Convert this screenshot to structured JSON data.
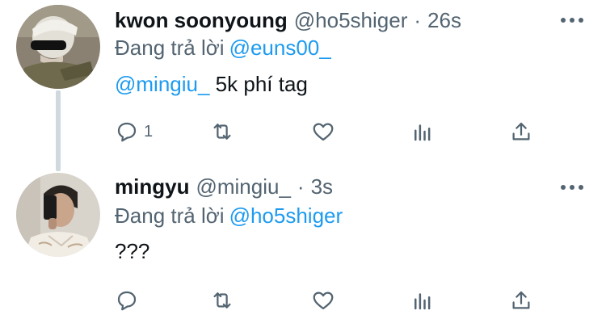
{
  "colors": {
    "link": "#1d9bf0",
    "secondary_text": "#536471",
    "primary_text": "#0f1419",
    "thread_line": "#cfd9de"
  },
  "tweets": [
    {
      "display_name": "kwon soonyoung",
      "handle": "@ho5shiger",
      "dot": "·",
      "time": "26s",
      "reply_prefix": "Đang trả lời",
      "reply_to": "@euns00_",
      "body_mention": "@mingiu_",
      "body_text": " 5k phí tag",
      "reply_count": "1",
      "icons": [
        "reply-icon",
        "retweet-icon",
        "like-icon",
        "views-icon",
        "share-icon",
        "more-icon"
      ]
    },
    {
      "display_name": "mingyu",
      "handle": "@mingiu_",
      "dot": "·",
      "time": "3s",
      "reply_prefix": "Đang trả lời",
      "reply_to": "@ho5shiger",
      "body_mention": "",
      "body_text": "???",
      "reply_count": "",
      "icons": [
        "reply-icon",
        "retweet-icon",
        "like-icon",
        "views-icon",
        "share-icon",
        "more-icon"
      ]
    }
  ]
}
